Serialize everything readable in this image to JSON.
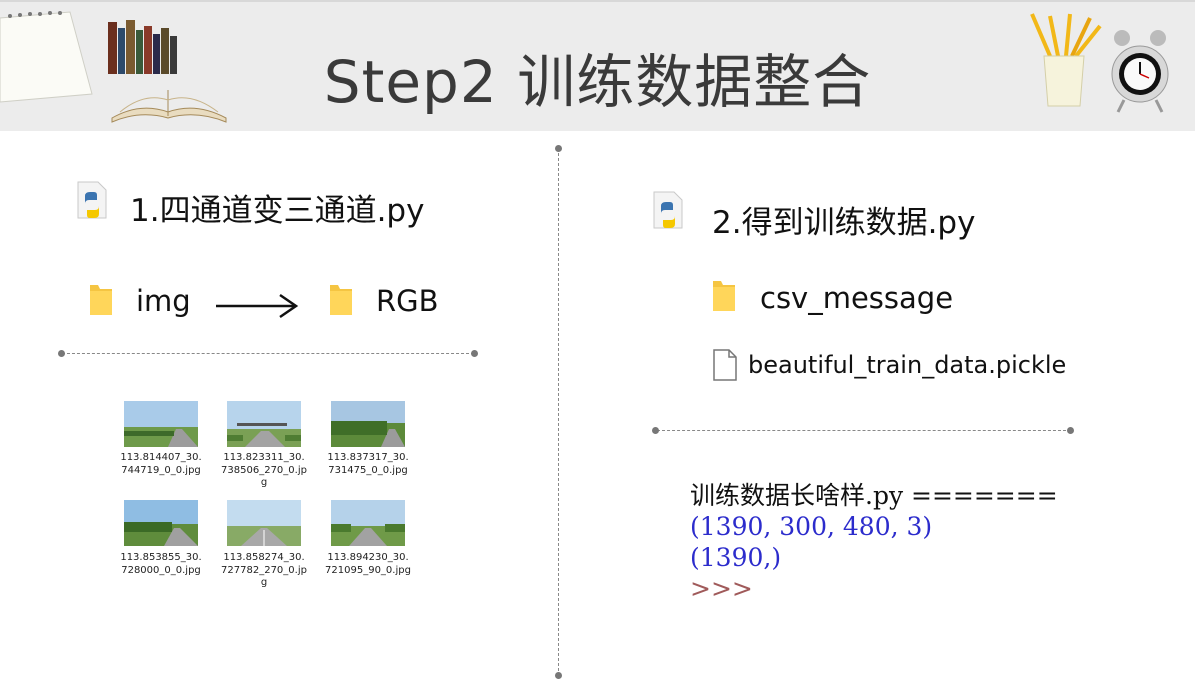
{
  "slide": {
    "title": "Step2 训练数据整合"
  },
  "left": {
    "script_title": "1.四通道变三通道.py",
    "source_folder": "img",
    "target_folder": "RGB",
    "thumbnails": [
      {
        "caption": "113.814407_30.744719_0_0.jpg"
      },
      {
        "caption": "113.823311_30.738506_270_0.jpg"
      },
      {
        "caption": "113.837317_30.731475_0_0.jpg"
      },
      {
        "caption": "113.853855_30.728000_0_0.jpg"
      },
      {
        "caption": "113.858274_30.727782_270_0.jpg"
      },
      {
        "caption": "113.894230_30.721095_90_0.jpg"
      }
    ]
  },
  "right": {
    "script_title": "2.得到训练数据.py",
    "folder": "csv_message",
    "file": "beautiful_train_data.pickle",
    "console": {
      "line1": "训练数据长啥样.py =======",
      "line2": "(1390, 300, 480, 3)",
      "line3": "(1390,)",
      "prompt": ">>>"
    }
  },
  "colors": {
    "header_bg": "#ececec",
    "title": "#3a3a3a",
    "console_output": "#2c2ccc",
    "console_prompt": "#a05a5a",
    "folder": "#f5c542"
  },
  "icons": [
    "notepad-icon",
    "books-icon",
    "open-book-icon",
    "pencil-cup-icon",
    "alarm-clock-icon",
    "python-file-icon",
    "folder-icon",
    "file-icon",
    "arrow-right-icon"
  ]
}
